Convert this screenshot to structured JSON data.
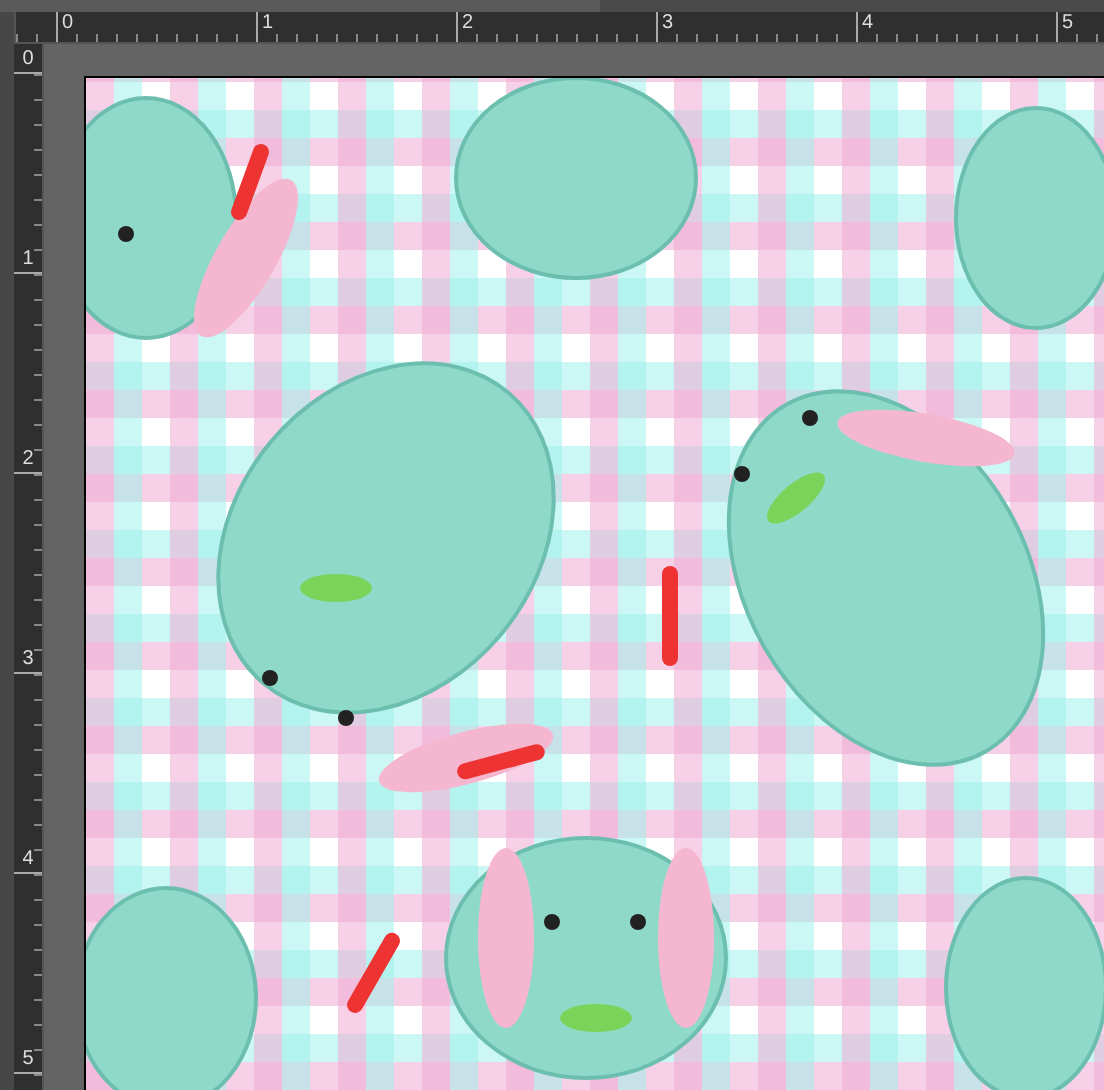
{
  "rulers": {
    "horizontal": [
      "0",
      "1",
      "2",
      "3",
      "4",
      "5"
    ],
    "vertical": [
      "0",
      "1",
      "2",
      "3",
      "4",
      "5"
    ]
  }
}
